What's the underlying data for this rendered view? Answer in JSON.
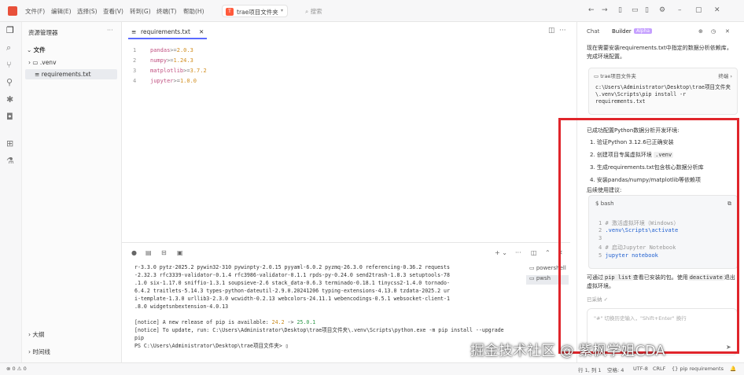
{
  "titlebar": {
    "menu": [
      "文件(F)",
      "编辑(E)",
      "选择(S)",
      "查看(V)",
      "转到(G)",
      "终端(T)",
      "帮助(H)"
    ],
    "project_badge": "T",
    "project_name": "trae项目文件夹",
    "search_label": "搜索"
  },
  "sidebar": {
    "title": "资源管理器",
    "section": "文件",
    "items": [
      ".venv",
      "requirements.txt"
    ],
    "bottom": [
      "大纲",
      "时间线"
    ]
  },
  "editor": {
    "tab_label": "requirements.txt",
    "lines": [
      {
        "num": "1",
        "pkg": "pandas",
        "op": ">=",
        "ver": "2.0.3"
      },
      {
        "num": "2",
        "pkg": "numpy",
        "op": ">=",
        "ver": "1.24.3"
      },
      {
        "num": "3",
        "pkg": "matplotlib",
        "op": ">=",
        "ver": "3.7.2"
      },
      {
        "num": "4",
        "pkg": "jupyter",
        "op": ">=",
        "ver": "1.0.0"
      }
    ]
  },
  "terminal": {
    "lines": [
      "r-3.3.0 pytz-2025.2 pywin32-310 pywinpty-2.0.15 pyyaml-6.0.2 pyzmq-26.3.0 referencing-0.36.2 requests",
      "-2.32.3 rfc3339-validator-0.1.4 rfc3986-validator-0.1.1 rpds-py-0.24.0 send2trash-1.8.3 setuptools-78",
      ".1.0 six-1.17.0 sniffio-1.3.1 soupsieve-2.6 stack_data-0.6.3 terminado-0.18.1 tinycss2-1.4.0 tornado-",
      "6.4.2 traitlets-5.14.3 types-python-dateutil-2.9.0.20241206 typing-extensions-4.13.0 tzdata-2025.2 ur",
      "i-template-1.3.0 urllib3-2.3.0 wcwidth-0.2.13 webcolors-24.11.1 webencodings-0.5.1 websocket-client-1",
      ".8.0 widgetsnbextension-4.0.13"
    ],
    "notice1_prefix": "[notice] A new release of pip is available: ",
    "notice1_old": "24.2",
    "notice1_arrow": " -> ",
    "notice1_new": "25.0.1",
    "notice2": "[notice] To update, run: C:\\Users\\Administrator\\Desktop\\trae项目文件夹\\.venv\\Scripts\\python.exe -m pip install --upgrade pip",
    "prompt": "PS C:\\Users\\Administrator\\Desktop\\trae项目文件夹> ",
    "sessions": [
      "powershell",
      "pwsh"
    ]
  },
  "chat": {
    "tab_chat": "Chat",
    "tab_builder": "Builder",
    "builder_badge": "Alpha",
    "intro": "现在需要安装requirements.txt中指定的数据分析依赖库，完成环境配置。",
    "cmd_folder": "trae项目文件夹",
    "cmd_run": "终端",
    "cmd_text": "c:\\Users\\Administrator\\Desktop\\trae项目文件夹\\.venv\\Scripts\\pip install -r requirements.txt",
    "done_title": "已成功配置Python数据分析开发环境:",
    "steps": [
      "1. 验证Python 3.12.6已正确安装",
      "2. 创建项目专属虚拟环境",
      "3. 生成requirements.txt包含核心数据分析库",
      "4. 安装pandas/numpy/matplotlib等依赖项"
    ],
    "step2_code": ".venv",
    "suggest_title": "后续使用建议:",
    "bash_label": "bash",
    "bash_lines": [
      {
        "n": "1",
        "t": "# 激活虚拟环境（Windows）",
        "kind": "c"
      },
      {
        "n": "2",
        "t": ".venv\\Scripts\\activate",
        "kind": "k"
      },
      {
        "n": "3",
        "t": "",
        "kind": "c"
      },
      {
        "n": "4",
        "t": "# 启动Jupyter Notebook",
        "kind": "c"
      },
      {
        "n": "5",
        "t": "jupyter notebook",
        "kind": "k"
      }
    ],
    "after_a": "可通过",
    "after_code1": "pip list",
    "after_b": "查看已安装的包。使用",
    "after_code2": "deactivate",
    "after_c": "退出虚拟环境。",
    "adopted": "已采纳",
    "input_placeholder": "\"#\" 切换历史输入，\"Shift+Enter\" 换行"
  },
  "statusbar": {
    "left": "⊗ 0  ⚠ 0",
    "items": [
      "行 1, 列 1",
      "空格: 4",
      "UTF-8",
      "CRLF",
      "{} pip requirements"
    ]
  },
  "watermark": "掘金技术社区 @ 紫枫学姐CDA",
  "colors": {
    "accent": "#5b6bff",
    "highlight_box": "#e0252b",
    "logo": "#e8503a"
  }
}
